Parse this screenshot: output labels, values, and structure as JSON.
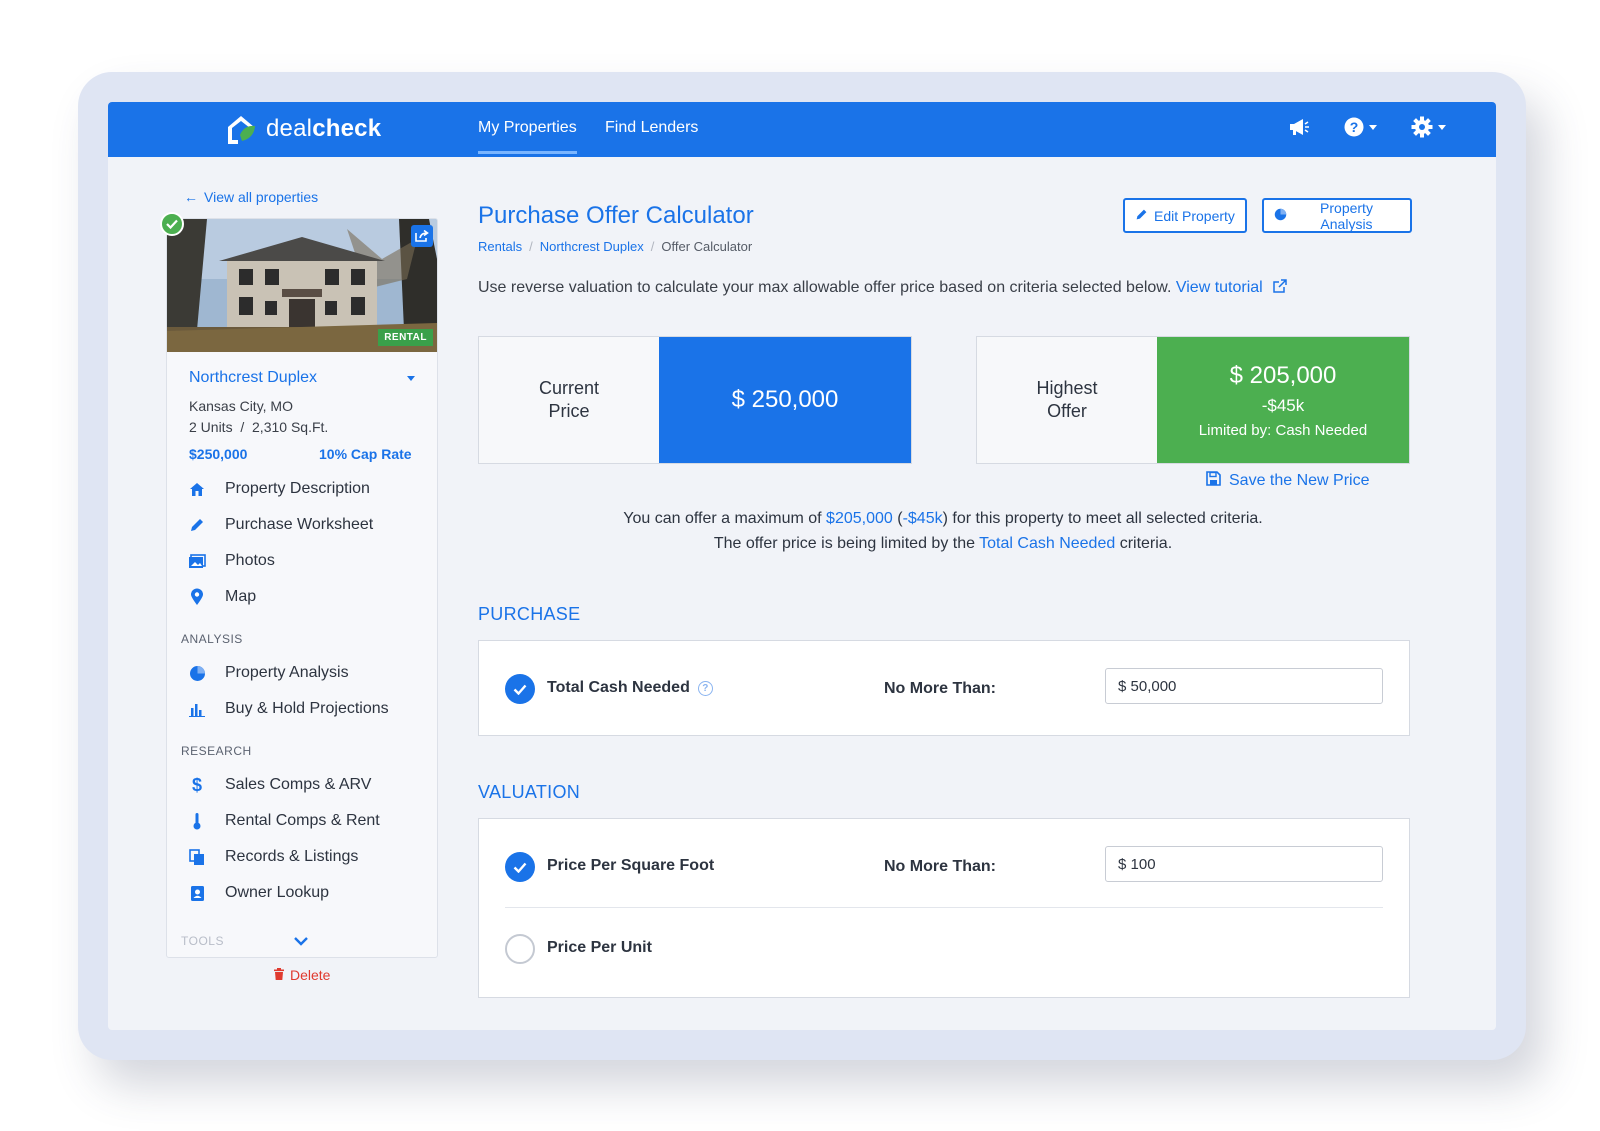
{
  "colors": {
    "primary": "#1a73e8",
    "success": "#4caf50",
    "danger": "#e03a2f",
    "background": "#f1f3f8"
  },
  "nav": {
    "logo_light": "deal",
    "logo_bold": "check",
    "links": [
      "My Properties",
      "Find Lenders"
    ],
    "active_link": "My Properties",
    "icons": [
      "megaphone-icon",
      "help-icon",
      "gear-icon"
    ]
  },
  "sidebar": {
    "back_link": "View all properties",
    "photo_tag": "RENTAL",
    "property": {
      "name": "Northcrest Duplex",
      "city": "Kansas City, MO",
      "units": "2 Units  /  2,310 Sq.Ft.",
      "price": "$250,000",
      "cap_rate": "10% Cap Rate"
    },
    "menu": [
      {
        "label": "Property Description",
        "icon": "home-icon"
      },
      {
        "label": "Purchase Worksheet",
        "icon": "pencil-icon"
      },
      {
        "label": "Photos",
        "icon": "photos-icon"
      },
      {
        "label": "Map",
        "icon": "map-pin-icon"
      }
    ],
    "analysis_label": "ANALYSIS",
    "analysis": [
      {
        "label": "Property Analysis",
        "icon": "pie-chart-icon"
      },
      {
        "label": "Buy & Hold Projections",
        "icon": "bar-chart-icon"
      }
    ],
    "research_label": "RESEARCH",
    "research": [
      {
        "label": "Sales Comps & ARV",
        "icon": "dollar-icon"
      },
      {
        "label": "Rental Comps & Rent",
        "icon": "thermometer-icon"
      },
      {
        "label": "Records & Listings",
        "icon": "documents-icon"
      },
      {
        "label": "Owner Lookup",
        "icon": "contact-book-icon"
      }
    ],
    "tools_label": "TOOLS",
    "delete_label": "Delete"
  },
  "main": {
    "title": "Purchase Offer Calculator",
    "edit_button": "Edit Property",
    "analysis_button": "Property Analysis",
    "breadcrumb": {
      "root": "Rentals",
      "parent": "Northcrest Duplex",
      "current": "Offer Calculator"
    },
    "intro_text": "Use reverse valuation to calculate your max allowable offer price based on criteria selected below.",
    "intro_link": "View tutorial",
    "current_price": {
      "label_line1": "Current",
      "label_line2": "Price",
      "value": "$ 250,000"
    },
    "highest_offer": {
      "label_line1": "Highest",
      "label_line2": "Offer",
      "value": "$ 205,000",
      "diff": "-$45k",
      "limit": "Limited by: Cash Needed"
    },
    "save_price": "Save the New Price",
    "summary": {
      "l1_pre": "You can offer a maximum of ",
      "l1_amount": "$205,000",
      "l1_open": " (",
      "l1_diff": "-$45k",
      "l1_post": ") for this property to meet all selected criteria.",
      "l2_pre": "The offer price is being limited by the ",
      "l2_link": "Total Cash Needed",
      "l2_post": " criteria."
    },
    "purchase": {
      "title": "PURCHASE",
      "rows": [
        {
          "label": "Total Cash Needed",
          "checked": true,
          "constraint": "No More Than:",
          "value": "$ 50,000"
        }
      ]
    },
    "valuation": {
      "title": "VALUATION",
      "rows": [
        {
          "label": "Price Per Square Foot",
          "checked": true,
          "constraint": "No More Than:",
          "value": "$ 100"
        },
        {
          "label": "Price Per Unit",
          "checked": false
        }
      ]
    }
  }
}
